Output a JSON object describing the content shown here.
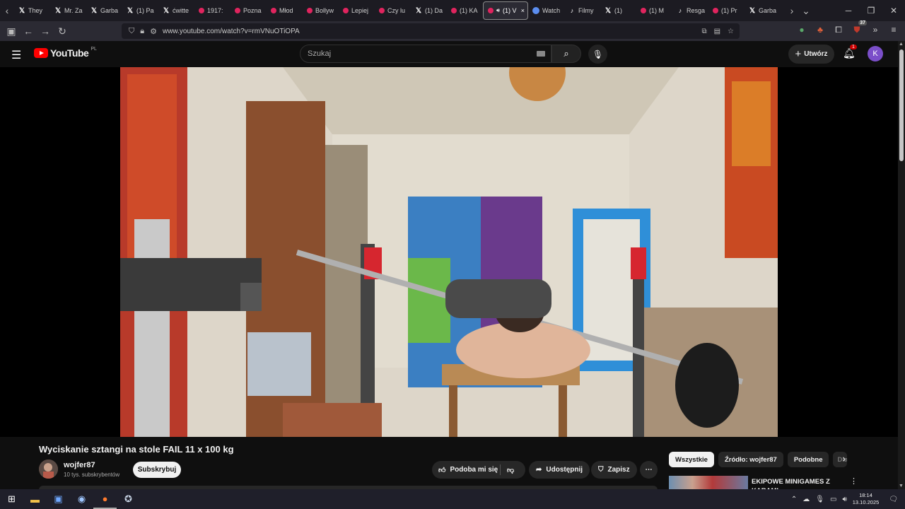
{
  "browser": {
    "tabs": [
      {
        "icon": "x-icon",
        "label": "They"
      },
      {
        "icon": "x-icon",
        "label": "Mr. Za"
      },
      {
        "icon": "x-icon",
        "label": "Garba"
      },
      {
        "icon": "x-icon",
        "label": "(1) Pa"
      },
      {
        "icon": "x-icon",
        "label": "ćwitte"
      },
      {
        "icon": "youtube-icon",
        "label": "1917:"
      },
      {
        "icon": "youtube-icon",
        "label": "Pozna"
      },
      {
        "icon": "youtube-icon",
        "label": "Młod"
      },
      {
        "icon": "youtube-icon",
        "label": "Bollyw"
      },
      {
        "icon": "youtube-icon",
        "label": "Lepiej"
      },
      {
        "icon": "youtube-icon",
        "label": "Czy lu"
      },
      {
        "icon": "x-icon",
        "label": "(1) Da"
      },
      {
        "icon": "youtube-icon",
        "label": "(1) KA"
      },
      {
        "icon": "youtube-icon",
        "label": "(1) V",
        "active": true
      },
      {
        "icon": "globe-icon",
        "label": "Watch"
      },
      {
        "icon": "tiktok-icon",
        "label": "Filmy"
      },
      {
        "icon": "x-icon",
        "label": "(1)"
      },
      {
        "icon": "youtube-icon",
        "label": "(1) M"
      },
      {
        "icon": "tiktok-icon",
        "label": "Resga"
      },
      {
        "icon": "youtube-icon",
        "label": "(1) Pr"
      },
      {
        "icon": "x-icon",
        "label": "Garba"
      }
    ],
    "active_tab_close": "×",
    "url": "www.youtube.com/watch?v=rmVNuOTiOPA",
    "extension_badge": "37"
  },
  "youtube": {
    "logo_text": "YouTube",
    "country_code": "PL",
    "search_placeholder": "Szukaj",
    "create_label": "Utwórz",
    "notifications_count": "1",
    "avatar_letter": "K"
  },
  "video": {
    "title": "Wyciskanie sztangi na stole FAIL 11 x 100 kg",
    "channel_name": "wojfer87",
    "subscribers": "10 tys. subskrybentów",
    "subscribe_label": "Subskrybuj",
    "like_label": "Podoba mi się",
    "share_label": "Udostępnij",
    "save_label": "Zapisz"
  },
  "sidebar": {
    "chips": [
      "Wszystkie",
      "Źródło: wojfer87",
      "Podobne",
      "Dla"
    ],
    "recommendation_title": "EKIPOWE MINIGAMES Z KARAMI"
  },
  "taskbar": {
    "time": "18:14",
    "date": "13.10.2025"
  },
  "colors": {
    "youtube_red": "#ff0000",
    "avatar_purple": "#7b4fc9",
    "background": "#0f0f0f"
  }
}
